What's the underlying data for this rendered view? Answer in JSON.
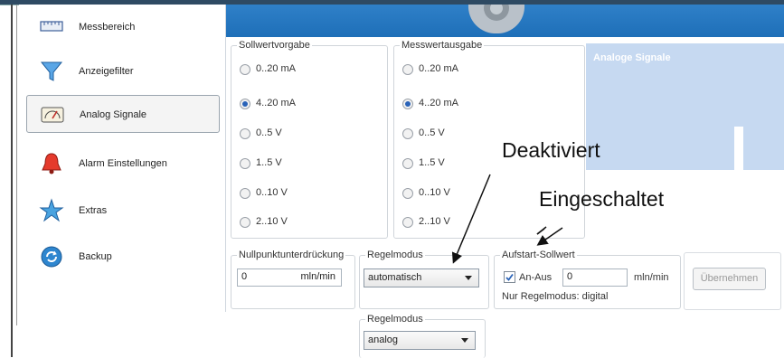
{
  "sidebar": {
    "items": [
      {
        "label": "Messbereich",
        "icon": "ruler-icon"
      },
      {
        "label": "Anzeigefilter",
        "icon": "filter-icon"
      },
      {
        "label": "Analog Signale",
        "icon": "gauge-icon",
        "active": true
      },
      {
        "label": "Alarm Einstellungen",
        "icon": "bell-icon"
      },
      {
        "label": "Extras",
        "icon": "star-icon"
      },
      {
        "label": "Backup",
        "icon": "backup-icon"
      }
    ]
  },
  "panel": {
    "title": "Analoge Signale"
  },
  "sollwertvorgabe": {
    "title": "Sollwertvorgabe",
    "options": [
      "0..20 mA",
      "4..20 mA",
      "0..5  V",
      "1..5 V",
      "0..10  V",
      "2..10 V"
    ],
    "selected": "4..20 mA"
  },
  "messwertausgabe": {
    "title": "Messwertausgabe",
    "options": [
      "0..20 mA",
      "4..20 mA",
      "0..5  V",
      "1..5 V",
      "0..10  V",
      "2..10 V"
    ],
    "selected": "4..20 mA"
  },
  "nullpunkt": {
    "title": "Nullpunktunterdrückung",
    "value": "0",
    "unit": "mln/min"
  },
  "regelmodus": {
    "title": "Regelmodus",
    "value": "automatisch"
  },
  "regelmodus2": {
    "title": "Regelmodus",
    "value": "analog"
  },
  "aufstart": {
    "title": "Aufstart-Sollwert",
    "checkbox_label": "An-Aus",
    "checked": true,
    "value": "0",
    "unit": "mln/min",
    "note": "Nur Regelmodus: digital"
  },
  "apply_button": "Übernehmen",
  "annotations": {
    "deaktiviert": "Deaktiviert",
    "eingeschaltet": "Eingeschaltet"
  },
  "colors": {
    "header_blue": "#2477c2",
    "panel_blue": "#c6d9f1",
    "radio_selected": "#2a63b8"
  }
}
